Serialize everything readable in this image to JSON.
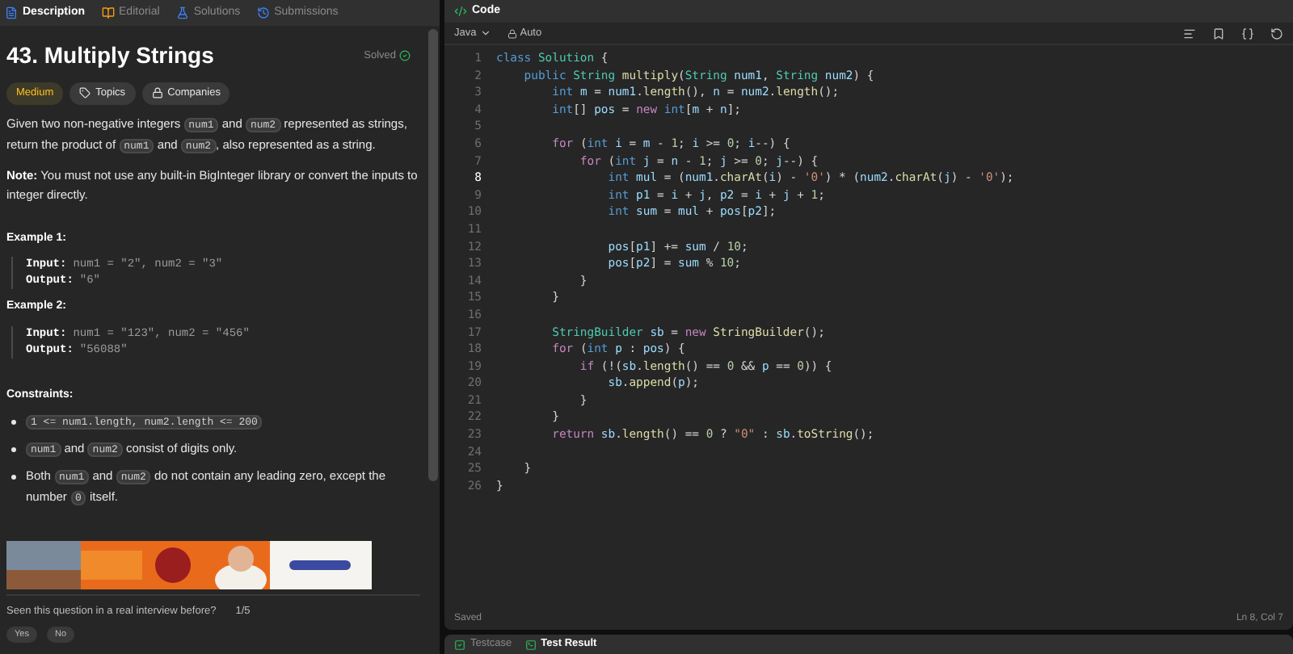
{
  "left_tabs": [
    {
      "label": "Description",
      "selected": true,
      "kind": "doc"
    },
    {
      "label": "Editorial",
      "selected": false,
      "kind": "book"
    },
    {
      "label": "Solutions",
      "selected": false,
      "kind": "flask"
    },
    {
      "label": "Submissions",
      "selected": false,
      "kind": "history"
    }
  ],
  "problem": {
    "title": "43. Multiply Strings",
    "status": "Solved",
    "tags": [
      {
        "label": "Medium",
        "kind": "difficulty"
      },
      {
        "label": "Topics",
        "kind": "topics"
      },
      {
        "label": "Companies",
        "kind": "companies"
      }
    ],
    "paragraphs": [
      [
        {
          "t": "Given two non-negative integers "
        },
        {
          "t": "num1",
          "code": true
        },
        {
          "t": " and "
        },
        {
          "t": "num2",
          "code": true
        },
        {
          "t": " represented as strings, return the product of "
        },
        {
          "t": "num1",
          "code": true
        },
        {
          "t": " and "
        },
        {
          "t": "num2",
          "code": true
        },
        {
          "t": ", also represented as a string."
        }
      ],
      [
        {
          "t": "Note:",
          "bold": true
        },
        {
          "t": " You must not use any built-in BigInteger library or convert the inputs to integer directly."
        }
      ]
    ],
    "examples": [
      {
        "heading": "Example 1:",
        "input_label": "Input:",
        "input": "num1 = \"2\", num2 = \"3\"",
        "output_label": "Output:",
        "output": "\"6\""
      },
      {
        "heading": "Example 2:",
        "input_label": "Input:",
        "input": "num1 = \"123\", num2 = \"456\"",
        "output_label": "Output:",
        "output": "\"56088\""
      }
    ],
    "constraints_heading": "Constraints:",
    "constraints": [
      [
        {
          "t": "1 <= num1.length, num2.length <= 200",
          "code": true
        }
      ],
      [
        {
          "t": "num1",
          "code": true
        },
        {
          "t": " and "
        },
        {
          "t": "num2",
          "code": true
        },
        {
          "t": " consist of digits only."
        }
      ],
      [
        {
          "t": "Both "
        },
        {
          "t": "num1",
          "code": true
        },
        {
          "t": " and "
        },
        {
          "t": "num2",
          "code": true
        },
        {
          "t": " do not contain any leading zero, except the number "
        },
        {
          "t": "0",
          "code": true
        },
        {
          "t": " itself."
        }
      ]
    ],
    "ad": {
      "kind": "picture"
    },
    "interview_question": "Seen this question in a real interview before?",
    "interview_count": "1/5",
    "answer_buttons": [
      "Yes",
      "No"
    ]
  },
  "editor": {
    "title": "Code",
    "language": "Java",
    "mode": "Auto",
    "lines": [
      {
        "n": "1",
        "current": false,
        "tokens": [
          {
            "kind": "type",
            "t": "class "
          },
          {
            "kind": "cls",
            "t": "Solution"
          },
          {
            "kind": "plain",
            "t": " {"
          }
        ]
      },
      {
        "n": "2",
        "current": false,
        "tokens": [
          {
            "kind": "type",
            "t": "    public "
          },
          {
            "kind": "cls",
            "t": "String "
          },
          {
            "kind": "fn",
            "t": "multiply"
          },
          {
            "kind": "plain",
            "t": "("
          },
          {
            "kind": "cls",
            "t": "String "
          },
          {
            "kind": "var",
            "t": "num1"
          },
          {
            "kind": "plain",
            "t": ", "
          },
          {
            "kind": "cls",
            "t": "String "
          },
          {
            "kind": "var",
            "t": "num2"
          },
          {
            "kind": "plain",
            "t": ") {"
          }
        ]
      },
      {
        "n": "3",
        "current": false,
        "tokens": [
          {
            "kind": "type",
            "t": "        int "
          },
          {
            "kind": "var",
            "t": "m"
          },
          {
            "kind": "plain",
            "t": " = "
          },
          {
            "kind": "var",
            "t": "num1"
          },
          {
            "kind": "plain",
            "t": "."
          },
          {
            "kind": "fn",
            "t": "length"
          },
          {
            "kind": "plain",
            "t": "(), "
          },
          {
            "kind": "var",
            "t": "n"
          },
          {
            "kind": "plain",
            "t": " = "
          },
          {
            "kind": "var",
            "t": "num2"
          },
          {
            "kind": "plain",
            "t": "."
          },
          {
            "kind": "fn",
            "t": "length"
          },
          {
            "kind": "plain",
            "t": "();"
          }
        ]
      },
      {
        "n": "4",
        "current": false,
        "tokens": [
          {
            "kind": "type",
            "t": "        int"
          },
          {
            "kind": "plain",
            "t": "[] "
          },
          {
            "kind": "var",
            "t": "pos"
          },
          {
            "kind": "plain",
            "t": " = "
          },
          {
            "kind": "kw",
            "t": "new "
          },
          {
            "kind": "type",
            "t": "int"
          },
          {
            "kind": "plain",
            "t": "["
          },
          {
            "kind": "var",
            "t": "m"
          },
          {
            "kind": "plain",
            "t": " + "
          },
          {
            "kind": "var",
            "t": "n"
          },
          {
            "kind": "plain",
            "t": "];"
          }
        ]
      },
      {
        "n": "5",
        "current": false
      },
      {
        "n": "6",
        "current": false,
        "tokens": [
          {
            "kind": "kw",
            "t": "        for "
          },
          {
            "kind": "plain",
            "t": "("
          },
          {
            "kind": "type",
            "t": "int "
          },
          {
            "kind": "var",
            "t": "i"
          },
          {
            "kind": "plain",
            "t": " = "
          },
          {
            "kind": "var",
            "t": "m"
          },
          {
            "kind": "plain",
            "t": " - "
          },
          {
            "kind": "num",
            "t": "1"
          },
          {
            "kind": "plain",
            "t": "; "
          },
          {
            "kind": "var",
            "t": "i"
          },
          {
            "kind": "plain",
            "t": " >= "
          },
          {
            "kind": "num",
            "t": "0"
          },
          {
            "kind": "plain",
            "t": "; "
          },
          {
            "kind": "var",
            "t": "i"
          },
          {
            "kind": "plain",
            "t": "--) {"
          }
        ]
      },
      {
        "n": "7",
        "current": false,
        "tokens": [
          {
            "kind": "kw",
            "t": "            for "
          },
          {
            "kind": "plain",
            "t": "("
          },
          {
            "kind": "type",
            "t": "int "
          },
          {
            "kind": "var",
            "t": "j"
          },
          {
            "kind": "plain",
            "t": " = "
          },
          {
            "kind": "var",
            "t": "n"
          },
          {
            "kind": "plain",
            "t": " - "
          },
          {
            "kind": "num",
            "t": "1"
          },
          {
            "kind": "plain",
            "t": "; "
          },
          {
            "kind": "var",
            "t": "j"
          },
          {
            "kind": "plain",
            "t": " >= "
          },
          {
            "kind": "num",
            "t": "0"
          },
          {
            "kind": "plain",
            "t": "; "
          },
          {
            "kind": "var",
            "t": "j"
          },
          {
            "kind": "plain",
            "t": "--) {"
          }
        ]
      },
      {
        "n": "8",
        "current": true,
        "tokens": [
          {
            "kind": "type",
            "t": "                int "
          },
          {
            "kind": "var",
            "t": "mul"
          },
          {
            "kind": "plain",
            "t": " = ("
          },
          {
            "kind": "var",
            "t": "num1"
          },
          {
            "kind": "plain",
            "t": "."
          },
          {
            "kind": "fn",
            "t": "charAt"
          },
          {
            "kind": "plain",
            "t": "("
          },
          {
            "kind": "var",
            "t": "i"
          },
          {
            "kind": "plain",
            "t": ") - "
          },
          {
            "kind": "str",
            "t": "'0'"
          },
          {
            "kind": "plain",
            "t": ") * ("
          },
          {
            "kind": "var",
            "t": "num2"
          },
          {
            "kind": "plain",
            "t": "."
          },
          {
            "kind": "fn",
            "t": "charAt"
          },
          {
            "kind": "plain",
            "t": "("
          },
          {
            "kind": "var",
            "t": "j"
          },
          {
            "kind": "plain",
            "t": ") - "
          },
          {
            "kind": "str",
            "t": "'0'"
          },
          {
            "kind": "plain",
            "t": ");"
          }
        ]
      },
      {
        "n": "9",
        "current": false,
        "tokens": [
          {
            "kind": "type",
            "t": "                int "
          },
          {
            "kind": "var",
            "t": "p1"
          },
          {
            "kind": "plain",
            "t": " = "
          },
          {
            "kind": "var",
            "t": "i"
          },
          {
            "kind": "plain",
            "t": " + "
          },
          {
            "kind": "var",
            "t": "j"
          },
          {
            "kind": "plain",
            "t": ", "
          },
          {
            "kind": "var",
            "t": "p2"
          },
          {
            "kind": "plain",
            "t": " = "
          },
          {
            "kind": "var",
            "t": "i"
          },
          {
            "kind": "plain",
            "t": " + "
          },
          {
            "kind": "var",
            "t": "j"
          },
          {
            "kind": "plain",
            "t": " + "
          },
          {
            "kind": "num",
            "t": "1"
          },
          {
            "kind": "plain",
            "t": ";"
          }
        ]
      },
      {
        "n": "10",
        "current": false,
        "tokens": [
          {
            "kind": "type",
            "t": "                int "
          },
          {
            "kind": "var",
            "t": "sum"
          },
          {
            "kind": "plain",
            "t": " = "
          },
          {
            "kind": "var",
            "t": "mul"
          },
          {
            "kind": "plain",
            "t": " + "
          },
          {
            "kind": "var",
            "t": "pos"
          },
          {
            "kind": "plain",
            "t": "["
          },
          {
            "kind": "var",
            "t": "p2"
          },
          {
            "kind": "plain",
            "t": "];"
          }
        ]
      },
      {
        "n": "11",
        "current": false
      },
      {
        "n": "12",
        "current": false,
        "tokens": [
          {
            "kind": "var",
            "t": "                pos"
          },
          {
            "kind": "plain",
            "t": "["
          },
          {
            "kind": "var",
            "t": "p1"
          },
          {
            "kind": "plain",
            "t": "] += "
          },
          {
            "kind": "var",
            "t": "sum"
          },
          {
            "kind": "plain",
            "t": " / "
          },
          {
            "kind": "num",
            "t": "10"
          },
          {
            "kind": "plain",
            "t": ";"
          }
        ]
      },
      {
        "n": "13",
        "current": false,
        "tokens": [
          {
            "kind": "var",
            "t": "                pos"
          },
          {
            "kind": "plain",
            "t": "["
          },
          {
            "kind": "var",
            "t": "p2"
          },
          {
            "kind": "plain",
            "t": "] = "
          },
          {
            "kind": "var",
            "t": "sum"
          },
          {
            "kind": "plain",
            "t": " % "
          },
          {
            "kind": "num",
            "t": "10"
          },
          {
            "kind": "plain",
            "t": ";"
          }
        ]
      },
      {
        "n": "14",
        "current": false,
        "tokens": [
          {
            "kind": "plain",
            "t": "            }"
          }
        ]
      },
      {
        "n": "15",
        "current": false,
        "tokens": [
          {
            "kind": "plain",
            "t": "        }"
          }
        ]
      },
      {
        "n": "16",
        "current": false
      },
      {
        "n": "17",
        "current": false,
        "tokens": [
          {
            "kind": "cls",
            "t": "        StringBuilder "
          },
          {
            "kind": "var",
            "t": "sb"
          },
          {
            "kind": "plain",
            "t": " = "
          },
          {
            "kind": "kw",
            "t": "new "
          },
          {
            "kind": "fn",
            "t": "StringBuilder"
          },
          {
            "kind": "plain",
            "t": "();"
          }
        ]
      },
      {
        "n": "18",
        "current": false,
        "tokens": [
          {
            "kind": "kw",
            "t": "        for "
          },
          {
            "kind": "plain",
            "t": "("
          },
          {
            "kind": "type",
            "t": "int "
          },
          {
            "kind": "var",
            "t": "p"
          },
          {
            "kind": "plain",
            "t": " : "
          },
          {
            "kind": "var",
            "t": "pos"
          },
          {
            "kind": "plain",
            "t": ") {"
          }
        ]
      },
      {
        "n": "19",
        "current": false,
        "tokens": [
          {
            "kind": "kw",
            "t": "            if "
          },
          {
            "kind": "plain",
            "t": "(!("
          },
          {
            "kind": "var",
            "t": "sb"
          },
          {
            "kind": "plain",
            "t": "."
          },
          {
            "kind": "fn",
            "t": "length"
          },
          {
            "kind": "plain",
            "t": "() == "
          },
          {
            "kind": "num",
            "t": "0"
          },
          {
            "kind": "plain",
            "t": " && "
          },
          {
            "kind": "var",
            "t": "p"
          },
          {
            "kind": "plain",
            "t": " == "
          },
          {
            "kind": "num",
            "t": "0"
          },
          {
            "kind": "plain",
            "t": ")) {"
          }
        ]
      },
      {
        "n": "20",
        "current": false,
        "tokens": [
          {
            "kind": "var",
            "t": "                sb"
          },
          {
            "kind": "plain",
            "t": "."
          },
          {
            "kind": "fn",
            "t": "append"
          },
          {
            "kind": "plain",
            "t": "("
          },
          {
            "kind": "var",
            "t": "p"
          },
          {
            "kind": "plain",
            "t": ");"
          }
        ]
      },
      {
        "n": "21",
        "current": false,
        "tokens": [
          {
            "kind": "plain",
            "t": "            }"
          }
        ]
      },
      {
        "n": "22",
        "current": false,
        "tokens": [
          {
            "kind": "plain",
            "t": "        }"
          }
        ]
      },
      {
        "n": "23",
        "current": false,
        "tokens": [
          {
            "kind": "kw",
            "t": "        return "
          },
          {
            "kind": "var",
            "t": "sb"
          },
          {
            "kind": "plain",
            "t": "."
          },
          {
            "kind": "fn",
            "t": "length"
          },
          {
            "kind": "plain",
            "t": "() == "
          },
          {
            "kind": "num",
            "t": "0"
          },
          {
            "kind": "plain",
            "t": " ? "
          },
          {
            "kind": "str",
            "t": "\"0\""
          },
          {
            "kind": "plain",
            "t": " : "
          },
          {
            "kind": "var",
            "t": "sb"
          },
          {
            "kind": "plain",
            "t": "."
          },
          {
            "kind": "fn",
            "t": "toString"
          },
          {
            "kind": "plain",
            "t": "();"
          }
        ]
      },
      {
        "n": "24",
        "current": false
      },
      {
        "n": "25",
        "current": false,
        "tokens": [
          {
            "kind": "plain",
            "t": "    }"
          }
        ]
      },
      {
        "n": "26",
        "current": false,
        "tokens": [
          {
            "kind": "plain",
            "t": "}"
          }
        ]
      }
    ],
    "status": "Saved",
    "cursor": "Ln 8, Col 7"
  },
  "bottom_tabs": [
    {
      "label": "Testcase",
      "selected": false
    },
    {
      "label": "Test Result",
      "selected": true
    }
  ]
}
